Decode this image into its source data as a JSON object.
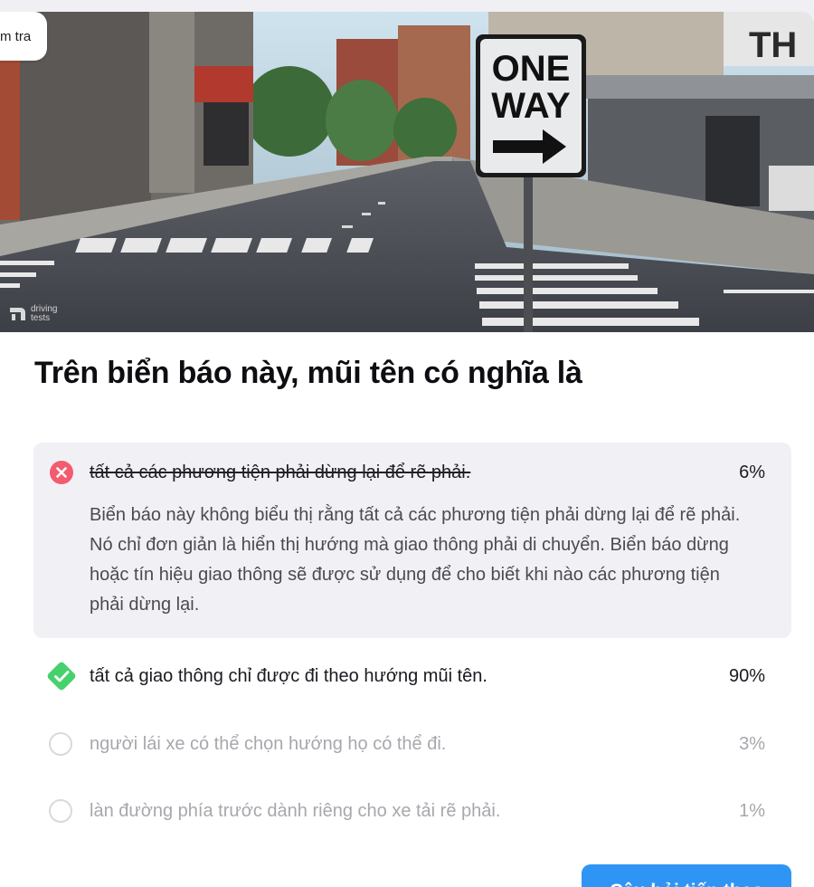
{
  "header": {
    "badge_label": "m tra"
  },
  "scene": {
    "sign_line1": "ONE",
    "sign_line2": "WAY",
    "watermark_line1": "driving",
    "watermark_line2": "tests",
    "building_sign": "TH"
  },
  "question": {
    "title": "Trên biển báo này, mũi tên có nghĩa là"
  },
  "answers": [
    {
      "text": "tất cả các phương tiện phải dừng lại để rẽ phải.",
      "percent": "6%",
      "state": "wrong",
      "explanation": "Biển báo này không biểu thị rằng tất cả các phương tiện phải dừng lại để rẽ phải. Nó chỉ đơn giản là hiển thị hướng mà giao thông phải di chuyển. Biển báo dừng hoặc tín hiệu giao thông sẽ được sử dụng để cho biết khi nào các phương tiện phải dừng lại."
    },
    {
      "text": "tất cả giao thông chỉ được đi theo hướng mũi tên.",
      "percent": "90%",
      "state": "correct"
    },
    {
      "text": "người lái xe có thể chọn hướng họ có thể đi.",
      "percent": "3%",
      "state": "unselected"
    },
    {
      "text": "làn đường phía trước dành riêng cho xe tải rẽ phải.",
      "percent": "1%",
      "state": "unselected"
    }
  ],
  "footer": {
    "next_label": "Câu hỏi tiếp theo"
  },
  "colors": {
    "wrong": "#f25c6e",
    "correct": "#47d16c",
    "primary": "#2f95f5"
  }
}
